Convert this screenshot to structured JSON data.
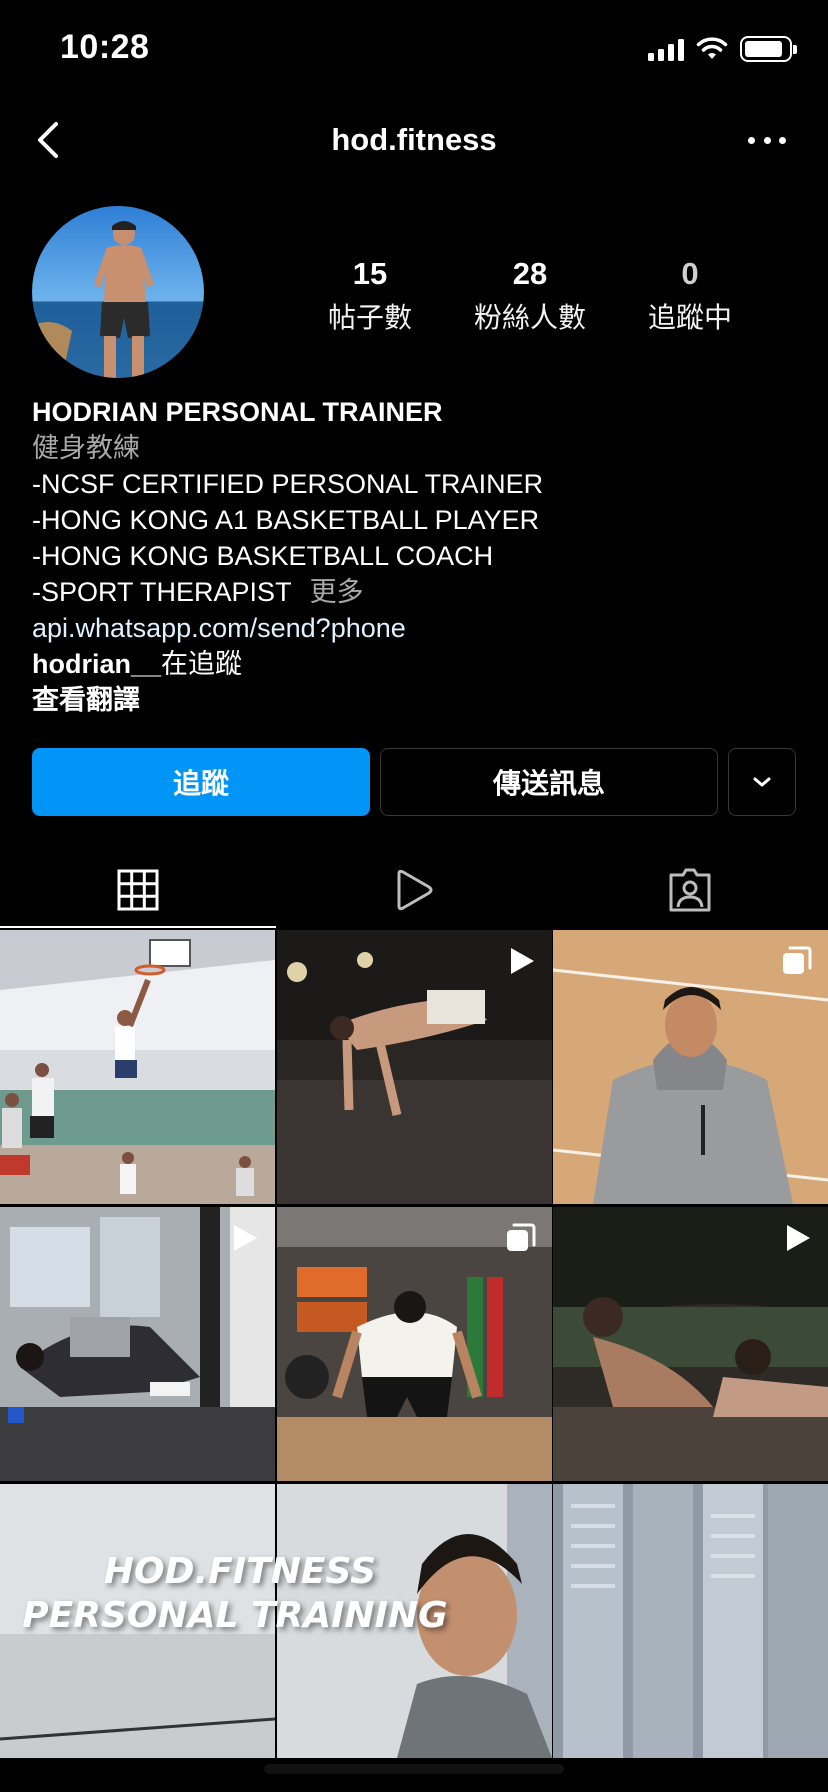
{
  "status_bar": {
    "time": "10:28",
    "icons": [
      "cellular-signal-icon",
      "wifi-icon",
      "battery-icon"
    ]
  },
  "nav": {
    "title": "hod.fitness",
    "back_icon": "chevron-left-icon",
    "more_icon": "more-horizontal-icon"
  },
  "profile": {
    "stats": [
      {
        "value": "15",
        "label": "帖子數"
      },
      {
        "value": "28",
        "label": "粉絲人數"
      },
      {
        "value": "0",
        "label": "追蹤中"
      }
    ],
    "name": "HODRIAN PERSONAL TRAINER",
    "category": "健身教練",
    "bio_lines": [
      "-NCSF CERTIFIED PERSONAL TRAINER",
      "-HONG KONG A1 BASKETBALL PLAYER",
      "-HONG KONG BASKETBALL COACH",
      "-SPORT THERAPIST"
    ],
    "more_label": "更多",
    "link": "api.whatsapp.com/send?phone",
    "followed_by_user": "hodrian__",
    "followed_by_suffix": "在追蹤",
    "translate_label": "查看翻譯"
  },
  "actions": {
    "follow_label": "追蹤",
    "message_label": "傳送訊息",
    "suggest_icon": "chevron-down-icon"
  },
  "tabs": [
    {
      "name": "grid",
      "icon": "grid-icon",
      "active": true
    },
    {
      "name": "reels",
      "icon": "reels-play-icon",
      "active": false
    },
    {
      "name": "tagged",
      "icon": "tagged-person-icon",
      "active": false
    }
  ],
  "posts": [
    {
      "badge": "none"
    },
    {
      "badge": "video"
    },
    {
      "badge": "carousel"
    },
    {
      "badge": "video"
    },
    {
      "badge": "carousel"
    },
    {
      "badge": "video"
    },
    {
      "badge": "none",
      "overlay_text": [
        "HOD.FITNESS",
        "PERSONAL TRAINING"
      ]
    },
    {
      "badge": "none"
    },
    {
      "badge": "none"
    }
  ],
  "colors": {
    "background": "#000000",
    "follow_button": "#0095f6",
    "secondary_text": "#a8a8a8",
    "border": "#363636"
  }
}
